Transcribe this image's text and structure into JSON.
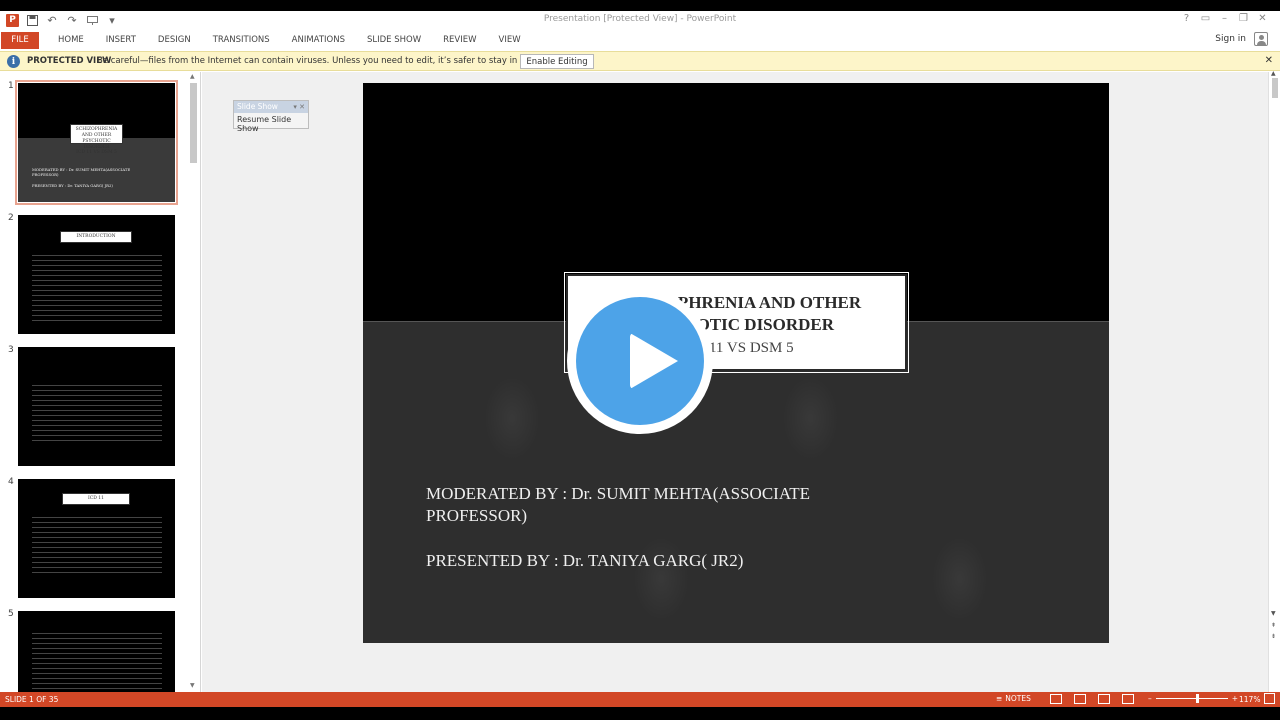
{
  "window": {
    "title": "Presentation [Protected View] - PowerPoint",
    "controls": [
      "?",
      "▭",
      "–",
      "❐",
      "✕"
    ]
  },
  "qat": {
    "logo": "P",
    "undo": "↶",
    "redo": "↷"
  },
  "ribbon": {
    "file": "FILE",
    "tabs": [
      "HOME",
      "INSERT",
      "DESIGN",
      "TRANSITIONS",
      "ANIMATIONS",
      "SLIDE SHOW",
      "REVIEW",
      "VIEW"
    ],
    "signin": "Sign in"
  },
  "protected_view": {
    "title": "PROTECTED VIEW",
    "message": "Be careful—files from the Internet can contain viruses. Unless you need to edit, it’s safer to stay in Protected View.",
    "button": "Enable Editing",
    "close": "✕"
  },
  "thumbnails": [
    {
      "num": "1"
    },
    {
      "num": "2",
      "heading": "INTRODUCTION"
    },
    {
      "num": "3"
    },
    {
      "num": "4",
      "heading": "ICD 11"
    },
    {
      "num": "5"
    }
  ],
  "slideshow_panel": {
    "title": "Slide Show",
    "resume": "Resume Slide Show"
  },
  "slide": {
    "title_line1": "SCHIZOPHRENIA AND OTHER",
    "title_line2": "PSYCHOTIC DISORDER",
    "subtitle": "ICD 11 VS DSM 5",
    "moderated_line1": "MODERATED BY : Dr. SUMIT MEHTA(ASSOCIATE",
    "moderated_line2": "PROFESSOR)",
    "presented": "PRESENTED BY : Dr. TANIYA GARG( JR2)"
  },
  "status": {
    "slide": "SLIDE 1 OF 35",
    "notes": "NOTES",
    "zoom": "117%"
  }
}
